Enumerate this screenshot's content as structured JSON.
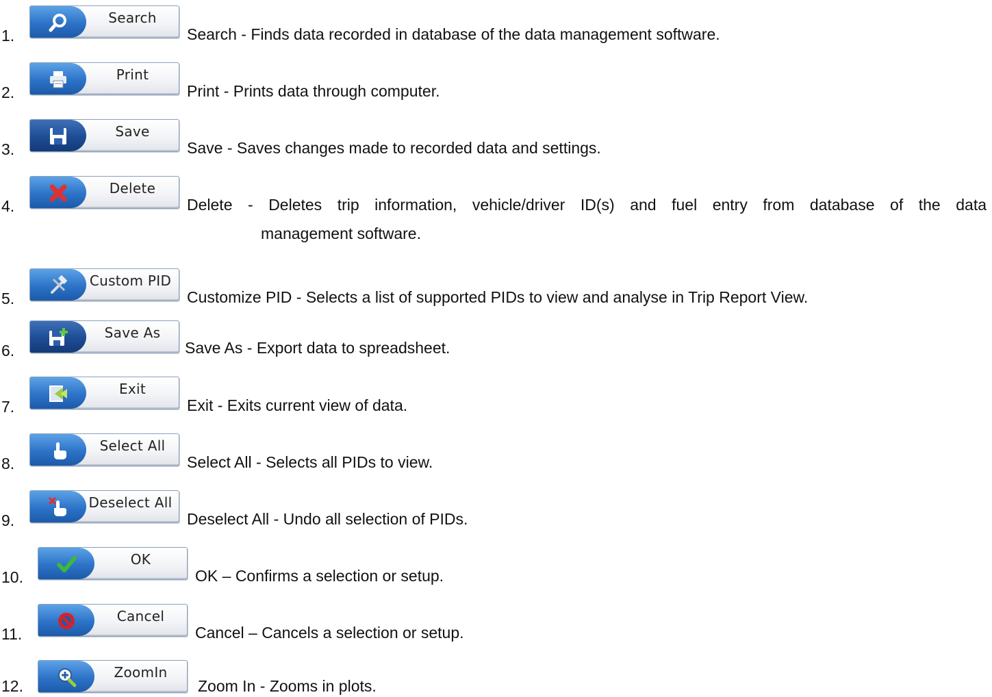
{
  "items": [
    {
      "num": "1.",
      "label": "Search",
      "title": "Search",
      "sep": "-",
      "desc": "Finds data recorded in database of the data management software.",
      "icon": "search-icon"
    },
    {
      "num": "2.",
      "label": "Print",
      "title": "Print",
      "sep": "-",
      "desc": "Prints data through computer.",
      "icon": "printer-icon"
    },
    {
      "num": "3.",
      "label": "Save",
      "title": "Save",
      "sep": "-",
      "desc": "Saves changes made to recorded data and settings.",
      "icon": "floppy-disk-icon"
    },
    {
      "num": "4.",
      "label": "Delete",
      "title": "Delete",
      "sep": "-",
      "desc_words": [
        "Deletes",
        "trip",
        "information,",
        "vehicle/driver",
        "ID(s)",
        "and",
        "fuel",
        "entry",
        "from",
        "database",
        "of",
        "the",
        "data"
      ],
      "desc_line2": "management software.",
      "icon": "delete-x-icon"
    },
    {
      "num": "5.",
      "label": "Custom PID",
      "title": "Customize PID",
      "sep": "-",
      "desc": "Selects a list of supported PIDs to view and analyse in Trip Report View.",
      "icon": "tools-icon"
    },
    {
      "num": "6.",
      "label": "Save As",
      "title": "Save As",
      "sep": "-",
      "desc": "Export data to spreadsheet.",
      "icon": "save-as-icon"
    },
    {
      "num": "7.",
      "label": "Exit",
      "title": "Exit",
      "sep": "-",
      "desc": "Exits current view of data.",
      "icon": "exit-icon"
    },
    {
      "num": "8.",
      "label": "Select All",
      "title": "Select All",
      "sep": "-",
      "desc": "Selects all PIDs to view.",
      "icon": "hand-pointer-icon"
    },
    {
      "num": "9.",
      "label": "Deselect All",
      "title": "Deselect All",
      "sep": "-",
      "desc": "Undo all selection of PIDs.",
      "icon": "hand-deselect-icon"
    },
    {
      "num": "10.",
      "label": "OK",
      "title": "OK",
      "sep": "–",
      "desc": "Confirms a selection or setup.",
      "icon": "checkmark-icon"
    },
    {
      "num": "11.",
      "label": "Cancel",
      "title": "Cancel",
      "sep": "–",
      "desc": "Cancels a selection or setup.",
      "icon": "no-entry-icon"
    },
    {
      "num": "12.",
      "label": "ZoomIn",
      "title": "Zoom In",
      "sep": "-",
      "desc": "Zooms in plots.",
      "icon": "zoom-in-icon"
    }
  ],
  "colors": {
    "cap_blue": "#2c73c8",
    "cap_dark": "#1d4c94",
    "check_green": "#3cb83c",
    "cancel_red": "#d8202a",
    "delete_red": "#e03030"
  }
}
